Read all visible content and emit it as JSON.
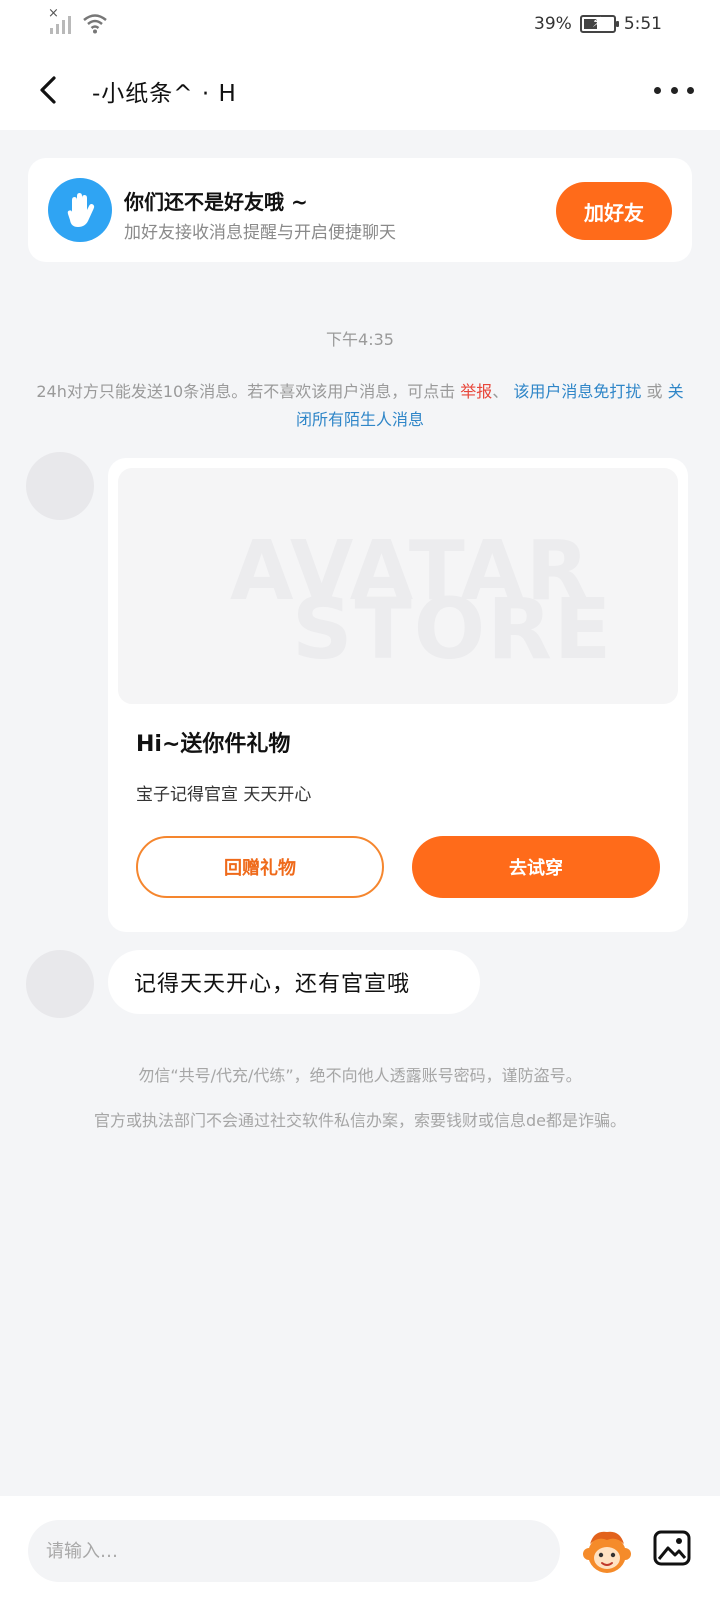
{
  "status_bar": {
    "battery": "39%",
    "time": "5:51"
  },
  "header": {
    "title": "-小纸条^ · H"
  },
  "friend_banner": {
    "title": "你们还不是好友哦 ~",
    "subtitle": "加好友接收消息提醒与开启便捷聊天",
    "button": "加好友"
  },
  "chat": {
    "time": "下午4:35",
    "notice": {
      "prefix": "24h对方只能发送10条消息。若不喜欢该用户消息，可点击",
      "report": "举报",
      "sep1": "、",
      "mute_user": "该用户消息免打扰",
      "sep2": "或",
      "close_all": "关闭所有陌生人消息"
    },
    "gift_card": {
      "watermark_line1": "AVATAR",
      "watermark_line2": "STORE",
      "title": "Hi~送你件礼物",
      "subtitle": "宝子记得官宣 天天开心",
      "return_button": "回赠礼物",
      "try_button": "去试穿"
    },
    "text_message": "记得天天开心，还有官宣哦",
    "warning1": "勿信“共号/代充/代练”，绝不向他人透露账号密码，谨防盗号。",
    "warning2": "官方或执法部门不会通过社交软件私信办案，索要钱财或信息de都是诈骗。"
  },
  "input_bar": {
    "placeholder": "请输入…"
  },
  "icons": {
    "back": "chevron-left-icon",
    "more": "more-dots-icon",
    "hand": "hand-wave-icon",
    "sticker": "monkey-sticker-icon",
    "image": "image-icon"
  },
  "colors": {
    "accent": "#ff6b1a",
    "link": "#2f86c8",
    "report": "#e8463a",
    "hand_bg": "#2fa4f3"
  }
}
